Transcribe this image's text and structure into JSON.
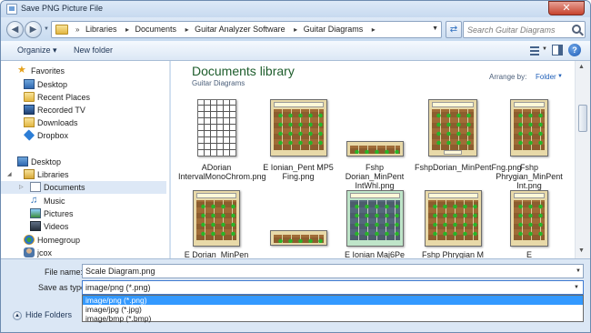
{
  "window": {
    "title": "Save PNG Picture File",
    "close_label": "✕"
  },
  "address": {
    "breadcrumbs": [
      "Libraries",
      "Documents",
      "Guitar Analyzer Software",
      "Guitar Diagrams"
    ],
    "search_placeholder": "Search Guitar Diagrams"
  },
  "toolbar": {
    "organize_label": "Organize ▾",
    "new_folder_label": "New folder",
    "help_label": "?"
  },
  "nav": {
    "items": [
      {
        "label": "Favorites",
        "icon": "star-icon"
      },
      {
        "label": "Desktop",
        "icon": "desktop-icon"
      },
      {
        "label": "Recent Places",
        "icon": "recent-places-icon"
      },
      {
        "label": "Recorded TV",
        "icon": "tv-icon"
      },
      {
        "label": "Downloads",
        "icon": "downloads-icon"
      },
      {
        "label": "Dropbox",
        "icon": "dropbox-icon"
      },
      {
        "label": "Desktop",
        "icon": "desktop-icon"
      },
      {
        "label": "Libraries",
        "icon": "libraries-icon"
      },
      {
        "label": "Documents",
        "icon": "documents-icon",
        "selected": true
      },
      {
        "label": "Music",
        "icon": "music-icon"
      },
      {
        "label": "Pictures",
        "icon": "pictures-icon"
      },
      {
        "label": "Videos",
        "icon": "videos-icon"
      },
      {
        "label": "Homegroup",
        "icon": "homegroup-icon"
      },
      {
        "label": "jcox",
        "icon": "user-icon"
      }
    ]
  },
  "library": {
    "title": "Documents library",
    "subtitle": "Guitar Diagrams",
    "arrange_label": "Arrange by:",
    "arrange_value": "Folder"
  },
  "files": [
    {
      "name": "ADorian IntervalMonoChrom.png",
      "style": "white"
    },
    {
      "name": "E Ionian_Pent MP5 Fing.png",
      "style": "tan"
    },
    {
      "name": "Fshp Dorian_MinPent IntWhl.png",
      "style": "tan"
    },
    {
      "name": "FshpDorian_MinPentFng.png",
      "style": "tan"
    },
    {
      "name": "Fshp Phrygian_MinPent Int.png",
      "style": "tan"
    },
    {
      "name": "E Dorian_MinPen",
      "style": "tan"
    },
    {
      "name": "",
      "style": "tan"
    },
    {
      "name": "E Ionian Maj6Pe",
      "style": "green"
    },
    {
      "name": "Fshp Phrygian M",
      "style": "tan"
    },
    {
      "name": "E",
      "style": "tan"
    }
  ],
  "bottom": {
    "file_name_label": "File name:",
    "file_name_value": "Scale Diagram.png",
    "save_type_label": "Save as type:",
    "save_type_value": "image/png (*.png)",
    "save_type_options": [
      "image/png (*.png)",
      "image/jpg (*.jpg)",
      "image/bmp (*.bmp)"
    ],
    "selected_option": 0,
    "hide_folders_label": "Hide Folders"
  },
  "colors": {
    "library_title": "#1e5d2c",
    "link_blue": "#1f5fb8",
    "selection": "#3399ff"
  }
}
